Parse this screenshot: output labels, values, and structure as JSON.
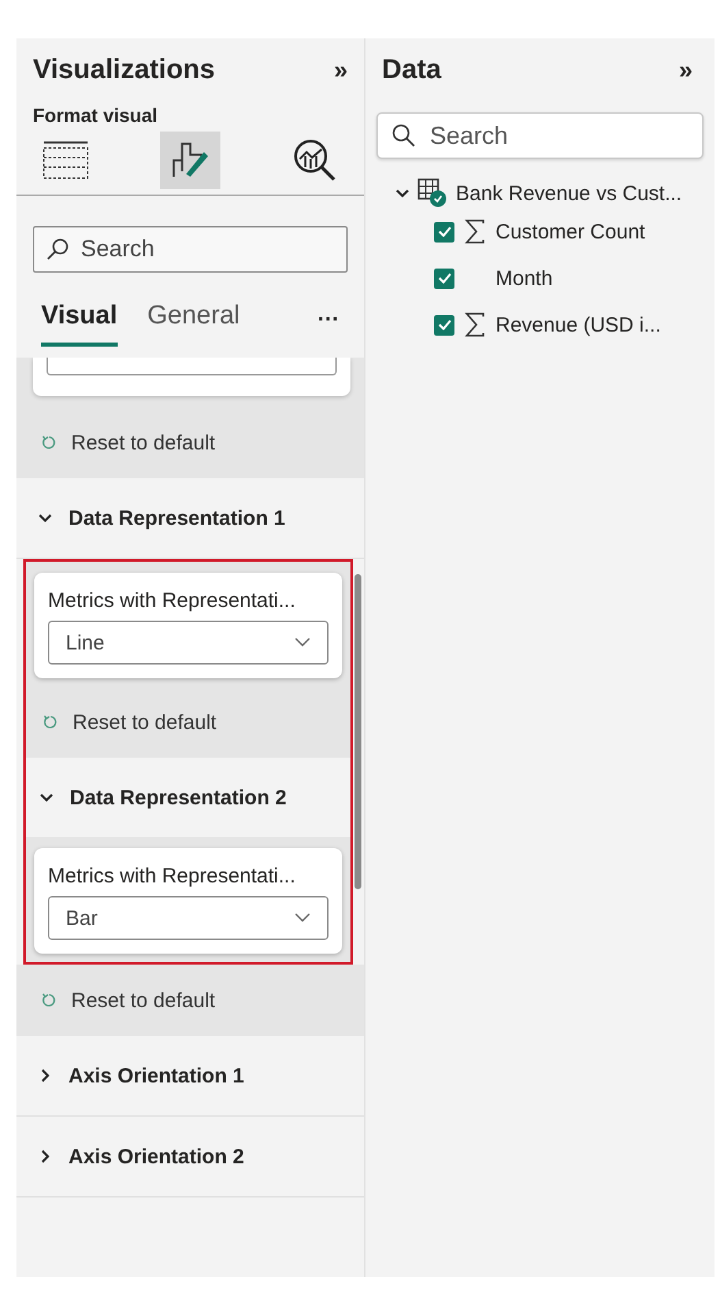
{
  "visualizations": {
    "title": "Visualizations",
    "collapse": "»",
    "subtitle": "Format visual",
    "views": [
      {
        "kind": "build",
        "selected": false
      },
      {
        "kind": "format",
        "selected": true
      },
      {
        "kind": "analytics",
        "selected": false
      }
    ],
    "search": {
      "placeholder": "Search"
    },
    "tabs": [
      {
        "label": "Visual",
        "selected": true
      },
      {
        "label": "General",
        "selected": false
      }
    ],
    "more": "···",
    "sections": [
      {
        "kind": "partial-card",
        "highlighted": false
      },
      {
        "kind": "reset",
        "label": "Reset to default",
        "highlighted": false
      },
      {
        "kind": "header",
        "label": "Data Representation 1",
        "expanded": true,
        "highlighted": false
      },
      {
        "kind": "card",
        "label": "Metrics with Representati...",
        "value": "Line",
        "highlighted": true
      },
      {
        "kind": "reset",
        "label": "Reset to default",
        "highlighted": true
      },
      {
        "kind": "header",
        "label": "Data Representation 2",
        "expanded": true,
        "highlighted": true
      },
      {
        "kind": "card",
        "label": "Metrics with Representati...",
        "value": "Bar",
        "highlighted": true
      },
      {
        "kind": "reset",
        "label": "Reset to default",
        "highlighted": false
      },
      {
        "kind": "header",
        "label": "Axis Orientation 1",
        "expanded": false,
        "highlighted": false
      },
      {
        "kind": "header",
        "label": "Axis Orientation 2",
        "expanded": false,
        "highlighted": false
      }
    ]
  },
  "data": {
    "title": "Data",
    "collapse": "»",
    "search": {
      "placeholder": "Search"
    },
    "tree": [
      {
        "label": "Bank Revenue vs Cust...",
        "expanded": true,
        "children": [
          {
            "label": "Customer Count",
            "checked": true,
            "kind": "measure"
          },
          {
            "label": "Month",
            "checked": true,
            "kind": "field"
          },
          {
            "label": "Revenue (USD i...",
            "checked": true,
            "kind": "measure"
          }
        ]
      }
    ]
  }
}
